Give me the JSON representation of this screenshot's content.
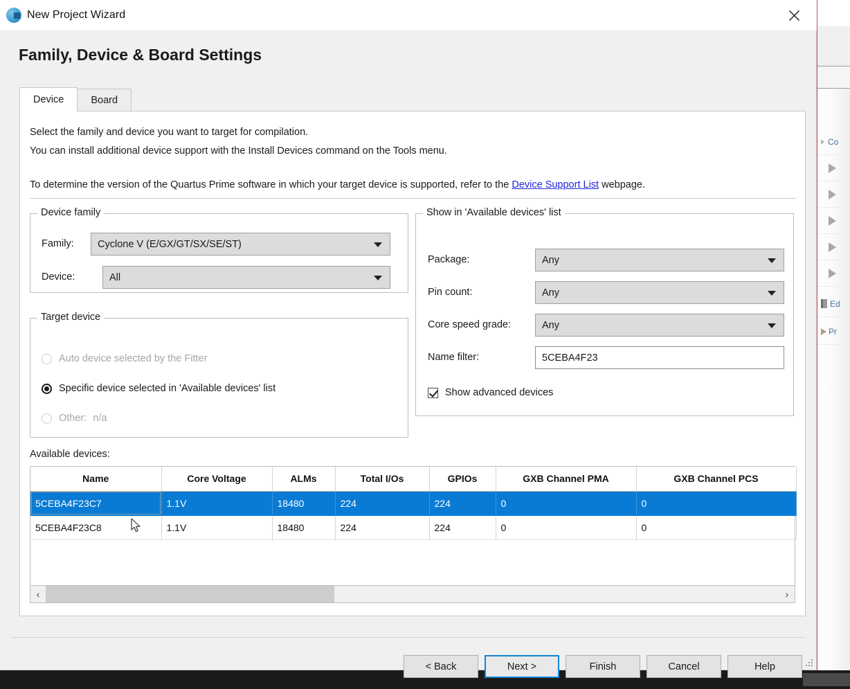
{
  "window": {
    "title": "New Project Wizard",
    "icon": "quartus-sphere-icon",
    "close_label": "✕"
  },
  "page": {
    "heading": "Family, Device & Board Settings"
  },
  "tabs": [
    {
      "label": "Device",
      "active": true
    },
    {
      "label": "Board",
      "active": false
    }
  ],
  "description": {
    "line1": "Select the family and device you want to target for compilation.",
    "line2": "You can install additional device support with the Install Devices command on the Tools menu.",
    "line3_before": "To determine the version of the Quartus Prime software in which your target device is supported, refer to the ",
    "link_text": "Device Support List",
    "line3_after": " webpage."
  },
  "device_family": {
    "legend": "Device family",
    "family_label": "Family:",
    "family_value": "Cyclone V (E/GX/GT/SX/SE/ST)",
    "device_label": "Device:",
    "device_value": "All"
  },
  "target_device": {
    "legend": "Target device",
    "options": [
      {
        "label": "Auto device selected by the Fitter",
        "selected": false,
        "enabled": false
      },
      {
        "label": "Specific device selected in 'Available devices' list",
        "selected": true,
        "enabled": true
      },
      {
        "label": "Other:",
        "value": "n/a",
        "selected": false,
        "enabled": false
      }
    ]
  },
  "show_filters": {
    "legend": "Show in 'Available devices' list",
    "package_label": "Package:",
    "package_value": "Any",
    "pin_count_label": "Pin count:",
    "pin_count_value": "Any",
    "core_speed_label": "Core speed grade:",
    "core_speed_value": "Any",
    "name_filter_label": "Name filter:",
    "name_filter_value": "5CEBA4F23",
    "name_filter_placeholder": "",
    "show_advanced_label": "Show advanced devices",
    "show_advanced_checked": true
  },
  "available_devices": {
    "label": "Available devices:",
    "columns": [
      "Name",
      "Core Voltage",
      "ALMs",
      "Total I/Os",
      "GPIOs",
      "GXB Channel PMA",
      "GXB Channel PCS"
    ],
    "rows": [
      {
        "selected": true,
        "cells": [
          "5CEBA4F23C7",
          "1.1V",
          "18480",
          "224",
          "224",
          "0",
          "0"
        ]
      },
      {
        "selected": false,
        "cells": [
          "5CEBA4F23C8",
          "1.1V",
          "18480",
          "224",
          "224",
          "0",
          "0"
        ]
      }
    ],
    "scroll_left_label": "‹",
    "scroll_right_label": "›"
  },
  "footer_buttons": [
    {
      "label": "< Back",
      "default": false
    },
    {
      "label": "Next >",
      "default": true
    },
    {
      "label": "Finish",
      "default": false
    },
    {
      "label": "Cancel",
      "default": false
    },
    {
      "label": "Help",
      "default": false
    }
  ],
  "background_app": {
    "rows": [
      {
        "icon": "caret-right-icon",
        "label": "Co"
      },
      {
        "icon": "play-triangle-icon",
        "label": ""
      },
      {
        "icon": "play-triangle-icon",
        "label": ""
      },
      {
        "icon": "play-triangle-icon",
        "label": ""
      },
      {
        "icon": "play-triangle-icon",
        "label": ""
      },
      {
        "icon": "play-triangle-icon",
        "label": ""
      },
      {
        "icon": "book-icon",
        "label": "Ed"
      },
      {
        "icon": "caret-right-icon",
        "label": "Pr"
      }
    ]
  },
  "colors": {
    "selection_blue": "#0a7bd4",
    "link_blue": "#2222dd",
    "default_button_border": "#1485d4",
    "dialog_bg": "#f0f0f0",
    "combo_bg": "#dcdcdc",
    "edge_marker_red": "#d4484a"
  }
}
